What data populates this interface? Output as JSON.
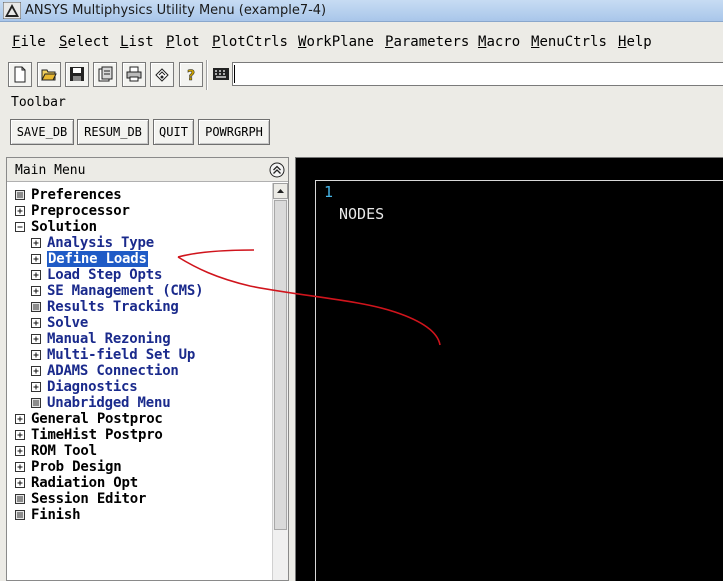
{
  "window": {
    "title": "ANSYS Multiphysics Utility Menu (example7-4)"
  },
  "menubar": [
    {
      "id": "file",
      "label": "File"
    },
    {
      "id": "select",
      "label": "Select"
    },
    {
      "id": "list",
      "label": "List"
    },
    {
      "id": "plot",
      "label": "Plot"
    },
    {
      "id": "plotctrls",
      "label": "PlotCtrls"
    },
    {
      "id": "workplane",
      "label": "WorkPlane"
    },
    {
      "id": "parameters",
      "label": "Parameters"
    },
    {
      "id": "macro",
      "label": "Macro"
    },
    {
      "id": "menuctrls",
      "label": "MenuCtrls"
    },
    {
      "id": "help",
      "label": "Help"
    }
  ],
  "icon_toolbar": {
    "buttons": [
      "new-file-icon",
      "open-folder-icon",
      "save-icon",
      "report-icon",
      "print-icon",
      "image-capture-icon",
      "help-icon"
    ],
    "command_icon": "keyboard-icon",
    "command_input": ""
  },
  "toolbar": {
    "label": "Toolbar",
    "buttons": [
      "SAVE_DB",
      "RESUM_DB",
      "QUIT",
      "POWRGRPH"
    ]
  },
  "main_menu": {
    "title": "Main Menu",
    "items": [
      {
        "label": "Preferences",
        "icon": "leaf",
        "level": 0
      },
      {
        "label": "Preprocessor",
        "icon": "expand",
        "level": 0
      },
      {
        "label": "Solution",
        "icon": "collapse",
        "level": 0
      },
      {
        "label": "Analysis Type",
        "icon": "expand",
        "level": 1
      },
      {
        "label": "Define Loads",
        "icon": "expand",
        "level": 1,
        "selected": true
      },
      {
        "label": "Load Step Opts",
        "icon": "expand",
        "level": 1
      },
      {
        "label": "SE Management (CMS)",
        "icon": "expand",
        "level": 1
      },
      {
        "label": "Results Tracking",
        "icon": "leaf",
        "level": 1
      },
      {
        "label": "Solve",
        "icon": "expand",
        "level": 1
      },
      {
        "label": "Manual Rezoning",
        "icon": "expand",
        "level": 1
      },
      {
        "label": "Multi-field Set Up",
        "icon": "expand",
        "level": 1
      },
      {
        "label": "ADAMS Connection",
        "icon": "expand",
        "level": 1
      },
      {
        "label": "Diagnostics",
        "icon": "expand",
        "level": 1
      },
      {
        "label": "Unabridged Menu",
        "icon": "leaf",
        "level": 1
      },
      {
        "label": "General Postproc",
        "icon": "expand",
        "level": 0
      },
      {
        "label": "TimeHist Postpro",
        "icon": "expand",
        "level": 0
      },
      {
        "label": "ROM Tool",
        "icon": "expand",
        "level": 0
      },
      {
        "label": "Prob Design",
        "icon": "expand",
        "level": 0
      },
      {
        "label": "Radiation Opt",
        "icon": "expand",
        "level": 0
      },
      {
        "label": "Session Editor",
        "icon": "leaf",
        "level": 0
      },
      {
        "label": "Finish",
        "icon": "leaf",
        "level": 0
      }
    ]
  },
  "graphics": {
    "window_number": "1",
    "label": "NODES"
  },
  "colors": {
    "selection": "#1f5bc6",
    "submenu_text": "#1a2a8c",
    "annotation": "#d0141c",
    "window_number": "#46b4e6"
  }
}
